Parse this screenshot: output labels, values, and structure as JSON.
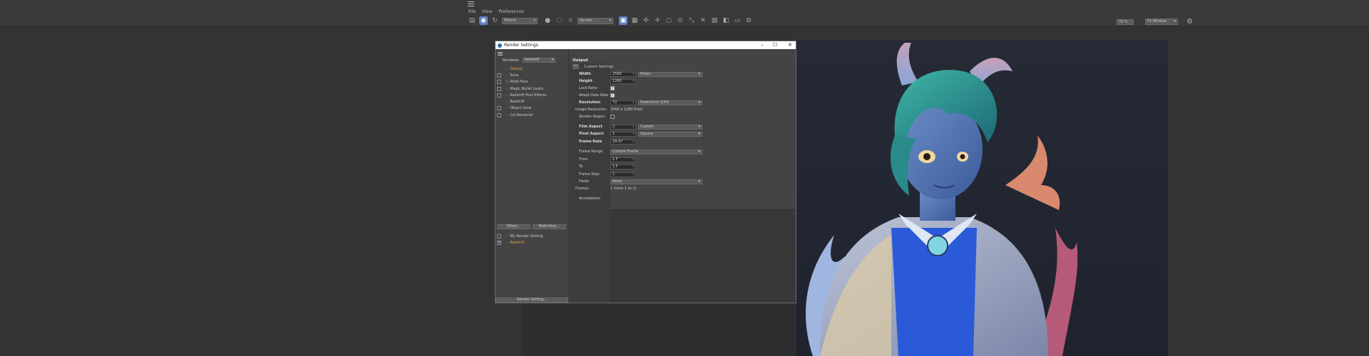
{
  "app": {
    "menus": [
      "File",
      "View",
      "Preferences"
    ],
    "toolbar": {
      "effects_drop": "Effects",
      "render_drop": "Render ...",
      "zoom": "70 %",
      "fit": "Fit Window"
    }
  },
  "dialog": {
    "title": "Render Settings",
    "renderer_label": "Renderer",
    "renderer_value": "Redshift",
    "tree": [
      {
        "label": "Output",
        "checkbox": false,
        "selected": true
      },
      {
        "label": "Save",
        "checkbox": true
      },
      {
        "label": "Multi-Pass",
        "checkbox": true,
        "expand": true
      },
      {
        "label": "Magic Bullet Looks",
        "checkbox": true
      },
      {
        "label": "Redshift Post-Effects",
        "checkbox": true
      },
      {
        "label": "Redshift",
        "checkbox": false
      },
      {
        "label": "Object Glow",
        "checkbox": true
      },
      {
        "label": "Cel Renderer",
        "checkbox": true
      }
    ],
    "effect_button": "Effect...",
    "multipass_button": "Multi-Pass...",
    "settings_list": [
      {
        "label": "My Render Setting",
        "checked": false
      },
      {
        "label": "Redshift",
        "checked": true,
        "selected": true
      }
    ],
    "render_setting_button": "Render Setting...",
    "output": {
      "heading": "Output",
      "custom_settings": "Custom Settings",
      "width_label": "Width",
      "width_value": "2560",
      "width_unit": "Pixels",
      "height_label": "Height",
      "height_value": "1280",
      "lock_ratio_label": "Lock Ratio",
      "adapt_label": "Adapt Data Rate",
      "resolution_label": "Resolution",
      "resolution_value": "72",
      "resolution_unit": "Pixels/Inch (DPI)",
      "image_res_label": "Image Resolution:",
      "image_res_value": "2560 x 1280 Pixel",
      "render_region_label": "Render Region",
      "film_aspect_label": "Film Aspect",
      "film_aspect_value": "2",
      "film_aspect_drop": "Custom",
      "pixel_aspect_label": "Pixel Aspect",
      "pixel_aspect_value": "1",
      "pixel_aspect_drop": "Square",
      "frame_rate_label": "Frame Rate",
      "frame_rate_value": "29.97",
      "frame_range_label": "Frame Range",
      "frame_range_drop": "Current Frame",
      "from_label": "From",
      "from_value": "1 F",
      "to_label": "To",
      "to_value": "1 F",
      "frame_step_label": "Frame Step",
      "frame_step_value": "1",
      "fields_label": "Fields",
      "fields_drop": "None",
      "frames_label": "Frames:",
      "frames_value": "1 (from 1 to 1)",
      "annotations_label": "Annotations"
    }
  },
  "colors": {
    "accent": "#5f7fc4",
    "selected_text": "#f0a040"
  }
}
